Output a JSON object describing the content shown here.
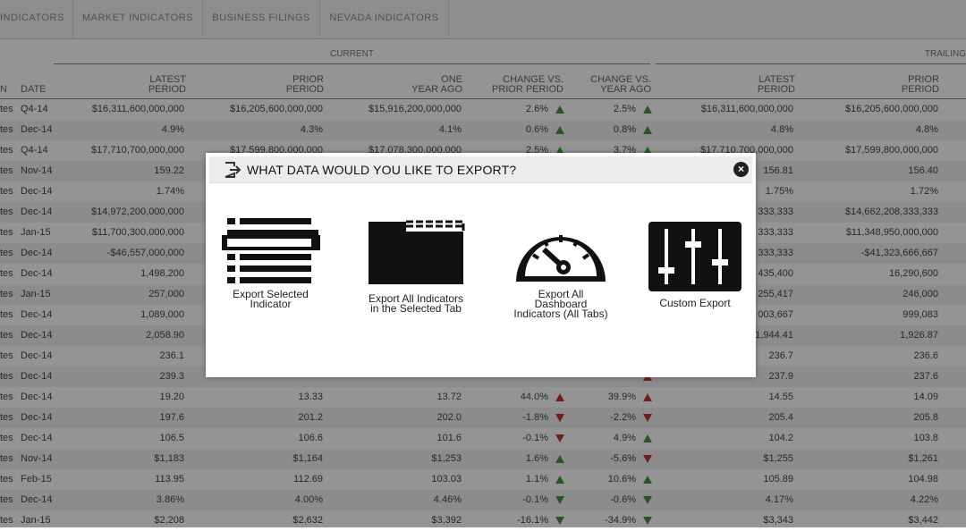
{
  "tabs": [
    "INDICATORS",
    "MARKET INDICATORS",
    "BUSINESS FILINGS",
    "NEVADA INDICATORS"
  ],
  "groups": {
    "current": "CURRENT",
    "trailing": "TRAILING"
  },
  "columns": {
    "n": "N",
    "date": "DATE",
    "latest": "LATEST\nPERIOD",
    "prior": "PRIOR\nPERIOD",
    "one_year": "ONE\nYEAR AGO",
    "chg_prior": "CHANGE VS.\nPRIOR PERIOD",
    "chg_year": "CHANGE VS.\nYEAR AGO",
    "t_latest": "LATEST\nPERIOD",
    "t_prior": "PRIOR\nPERIOD"
  },
  "rows": [
    {
      "n": "tes",
      "date": "Q4-14",
      "latest": "$16,311,600,000,000",
      "prior": "$16,205,600,000,000",
      "one_year": "$15,916,200,000,000",
      "chg_prior": "2.6%",
      "chg_prior_dir": "up",
      "chg_year": "2.5%",
      "chg_year_dir": "up",
      "t_latest": "$16,311,600,000,000",
      "t_prior": "$16,205,600,000,000"
    },
    {
      "n": "tes",
      "date": "Dec-14",
      "latest": "4.9%",
      "prior": "4.3%",
      "one_year": "4.1%",
      "chg_prior": "0.6%",
      "chg_prior_dir": "up",
      "chg_year": "0.8%",
      "chg_year_dir": "up",
      "t_latest": "4.8%",
      "t_prior": "4.8%"
    },
    {
      "n": "tes",
      "date": "Q4-14",
      "latest": "$17,710,700,000,000",
      "prior": "$17,599,800,000,000",
      "one_year": "$17,078,300,000,000",
      "chg_prior": "2.5%",
      "chg_prior_dir": "up",
      "chg_year": "3.7%",
      "chg_year_dir": "up",
      "t_latest": "$17,710,700,000,000",
      "t_prior": "$17,599,800,000,000"
    },
    {
      "n": "tes",
      "date": "Nov-14",
      "latest": "159.22",
      "prior": "",
      "one_year": "",
      "chg_prior": "",
      "chg_prior_dir": "",
      "chg_year": "",
      "chg_year_dir": "",
      "t_latest": "156.81",
      "t_prior": "156.40"
    },
    {
      "n": "tes",
      "date": "Dec-14",
      "latest": "1.74%",
      "prior": "",
      "one_year": "",
      "chg_prior": "",
      "chg_prior_dir": "",
      "chg_year": "",
      "chg_year_dir": "",
      "t_latest": "1.75%",
      "t_prior": "1.72%"
    },
    {
      "n": "tes",
      "date": "Dec-14",
      "latest": "$14,972,200,000,000",
      "prior": "",
      "one_year": "",
      "chg_prior": "",
      "chg_prior_dir": "",
      "chg_year": "",
      "chg_year_dir": "",
      "t_latest": "333,333",
      "t_prior": "$14,662,208,333,333"
    },
    {
      "n": "tes",
      "date": "Jan-15",
      "latest": "$11,700,300,000,000",
      "prior": "",
      "one_year": "",
      "chg_prior": "",
      "chg_prior_dir": "",
      "chg_year": "",
      "chg_year_dir": "",
      "t_latest": "333,333",
      "t_prior": "$11,348,950,000,000"
    },
    {
      "n": "tes",
      "date": "Dec-14",
      "latest": "-$46,557,000,000",
      "prior": "",
      "one_year": "",
      "chg_prior": "",
      "chg_prior_dir": "",
      "chg_year": "",
      "chg_year_dir": "",
      "t_latest": "333,333",
      "t_prior": "-$41,323,666,667"
    },
    {
      "n": "tes",
      "date": "Dec-14",
      "latest": "1,498,200",
      "prior": "",
      "one_year": "",
      "chg_prior": "",
      "chg_prior_dir": "",
      "chg_year": "",
      "chg_year_dir": "",
      "t_latest": "435,400",
      "t_prior": "16,290,600"
    },
    {
      "n": "tes",
      "date": "Jan-15",
      "latest": "257,000",
      "prior": "",
      "one_year": "",
      "chg_prior": "",
      "chg_prior_dir": "",
      "chg_year": "",
      "chg_year_dir": "",
      "t_latest": "255,417",
      "t_prior": "246,000"
    },
    {
      "n": "tes",
      "date": "Dec-14",
      "latest": "1,089,000",
      "prior": "",
      "one_year": "",
      "chg_prior": "",
      "chg_prior_dir": "",
      "chg_year": "",
      "chg_year_dir": "",
      "t_latest": "003,667",
      "t_prior": "999,083"
    },
    {
      "n": "tes",
      "date": "Dec-14",
      "latest": "2,058.90",
      "prior": "",
      "one_year": "",
      "chg_prior": "",
      "chg_prior_dir": "",
      "chg_year": "",
      "chg_year_dir": "",
      "t_latest": "1,944.41",
      "t_prior": "1,926.87"
    },
    {
      "n": "tes",
      "date": "Dec-14",
      "latest": "236.1",
      "prior": "",
      "one_year": "",
      "chg_prior": "",
      "chg_prior_dir": "",
      "chg_year": "",
      "chg_year_dir": "",
      "t_latest": "236.7",
      "t_prior": "236.6"
    },
    {
      "n": "tes",
      "date": "Dec-14",
      "latest": "239.3",
      "prior": "",
      "one_year": "",
      "chg_prior": "",
      "chg_prior_dir": "",
      "chg_year": "",
      "chg_year_dir": "red-up",
      "t_latest": "237.9",
      "t_prior": "237.6"
    },
    {
      "n": "tes",
      "date": "Dec-14",
      "latest": "19.20",
      "prior": "13.33",
      "one_year": "13.72",
      "chg_prior": "44.0%",
      "chg_prior_dir": "red-up",
      "chg_year": "39.9%",
      "chg_year_dir": "red-up",
      "t_latest": "14.55",
      "t_prior": "14.09"
    },
    {
      "n": "tes",
      "date": "Dec-14",
      "latest": "197.6",
      "prior": "201.2",
      "one_year": "202.0",
      "chg_prior": "-1.8%",
      "chg_prior_dir": "down",
      "chg_year": "-2.2%",
      "chg_year_dir": "down",
      "t_latest": "205.4",
      "t_prior": "205.8"
    },
    {
      "n": "tes",
      "date": "Dec-14",
      "latest": "106.5",
      "prior": "106.6",
      "one_year": "101.6",
      "chg_prior": "-0.1%",
      "chg_prior_dir": "down",
      "chg_year": "4.9%",
      "chg_year_dir": "up",
      "t_latest": "104.2",
      "t_prior": "103.8"
    },
    {
      "n": "tes",
      "date": "Nov-14",
      "latest": "$1,183",
      "prior": "$1,164",
      "one_year": "$1,253",
      "chg_prior": "1.6%",
      "chg_prior_dir": "up",
      "chg_year": "-5.6%",
      "chg_year_dir": "down",
      "t_latest": "$1,255",
      "t_prior": "$1,261"
    },
    {
      "n": "tes",
      "date": "Feb-15",
      "latest": "113.95",
      "prior": "112.69",
      "one_year": "103.03",
      "chg_prior": "1.1%",
      "chg_prior_dir": "up",
      "chg_year": "10.6%",
      "chg_year_dir": "up",
      "t_latest": "105.89",
      "t_prior": "104.98"
    },
    {
      "n": "tes",
      "date": "Dec-14",
      "latest": "3.86%",
      "prior": "4.00%",
      "one_year": "4.46%",
      "chg_prior": "-0.1%",
      "chg_prior_dir": "green-down",
      "chg_year": "-0.6%",
      "chg_year_dir": "green-down",
      "t_latest": "4.17%",
      "t_prior": "4.22%"
    },
    {
      "n": "tes",
      "date": "Jan-15",
      "latest": "$2,208",
      "prior": "$2,632",
      "one_year": "$3,392",
      "chg_prior": "-16.1%",
      "chg_prior_dir": "green-down",
      "chg_year": "-34.9%",
      "chg_year_dir": "green-down",
      "t_latest": "$3,343",
      "t_prior": "$3,442"
    }
  ],
  "modal": {
    "title": "WHAT DATA WOULD YOU LIKE TO EXPORT?",
    "header_icon": "export-icon",
    "close_icon": "close-icon",
    "options": [
      {
        "label": "Export Selected\nIndicator",
        "icon": "list-icon"
      },
      {
        "label": "Export All Indicators\nin the Selected Tab",
        "icon": "folder-icon"
      },
      {
        "label": "Export All\nDashboard\nIndicators (All Tabs)",
        "icon": "gauge-icon"
      },
      {
        "label": "Custom Export",
        "icon": "sliders-icon"
      }
    ]
  }
}
